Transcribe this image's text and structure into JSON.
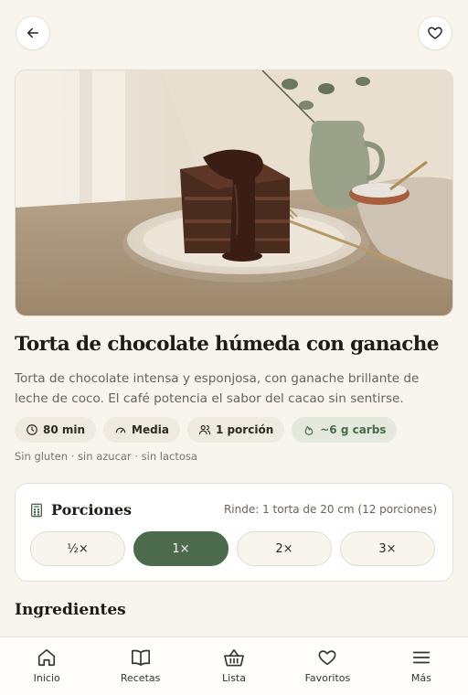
{
  "header": {
    "back_icon": "arrow-left-icon",
    "favorite_icon": "heart-icon"
  },
  "hero": {
    "alt": "Torta de chocolate con ganache"
  },
  "recipe": {
    "title": "Torta de chocolate húmeda con ganache",
    "description": "Torta de chocolate intensa y esponjosa, con ganache brillante de leche de coco. El café potencia el sabor del cacao sin sentirse.",
    "chips": [
      {
        "icon": "clock-icon",
        "label": "80 min"
      },
      {
        "icon": "gauge-icon",
        "label": "Media"
      },
      {
        "icon": "people-icon",
        "label": "1 porción"
      },
      {
        "icon": "flame-icon",
        "label": "~6 g carbs"
      }
    ],
    "notes": "Sin gluten · sin azucar · sin lactosa"
  },
  "portions": {
    "title": "Porciones",
    "yield": "Rinde: 1 torta de 20 cm (12 porciones)",
    "options": [
      "½×",
      "1×",
      "2×",
      "3×"
    ],
    "selected": "1×"
  },
  "ingredients": {
    "title": "Ingredientes"
  },
  "tabbar": {
    "items": [
      {
        "icon": "home-icon",
        "label": "Inicio"
      },
      {
        "icon": "book-icon",
        "label": "Recetas"
      },
      {
        "icon": "basket-icon",
        "label": "Lista"
      },
      {
        "icon": "heart-icon",
        "label": "Favoritos"
      },
      {
        "icon": "menu-icon",
        "label": "Más"
      }
    ]
  },
  "colors": {
    "background": "#f8f5ee",
    "accent": "#4b6b4c",
    "chip_green_bg": "#e3e9dc",
    "text": "#1e1a16"
  }
}
